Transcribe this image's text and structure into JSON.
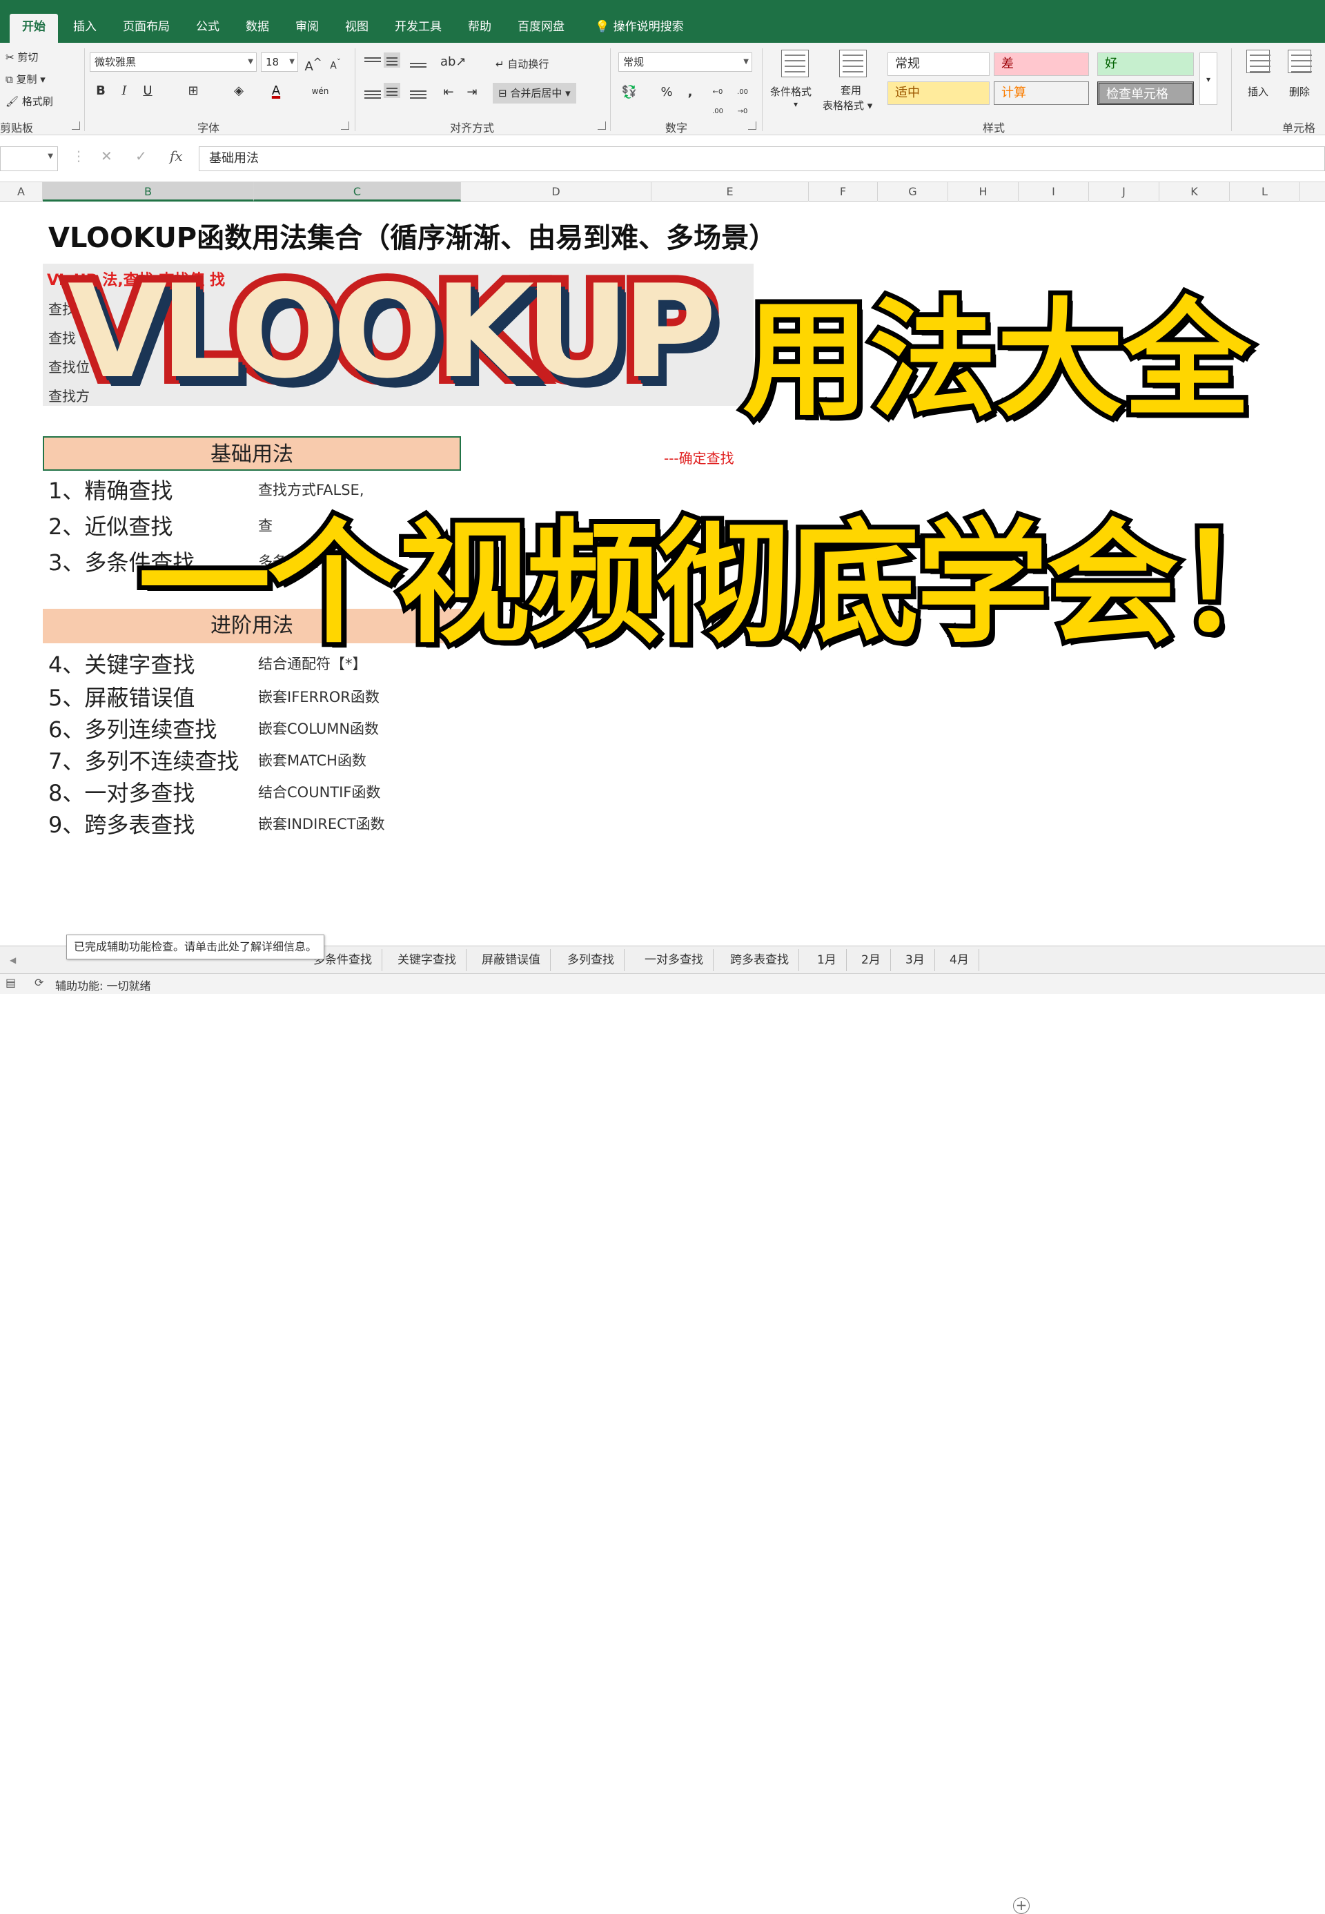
{
  "ribbon_tabs": [
    "开始",
    "插入",
    "页面布局",
    "公式",
    "数据",
    "审阅",
    "视图",
    "开发工具",
    "帮助",
    "百度网盘",
    "操作说明搜索"
  ],
  "clipboard": {
    "cut": "剪切",
    "copy": "复制",
    "painter": "格式刷",
    "group": "剪贴板"
  },
  "font": {
    "name": "微软雅黑",
    "size": "18",
    "bold": "B",
    "italic": "I",
    "underline": "U",
    "grow": "A",
    "shrink": "A",
    "color_glyph": "A",
    "phonetic": "wén",
    "group": "字体"
  },
  "align": {
    "wrap": "自动换行",
    "merge": "合并后居中",
    "group": "对齐方式"
  },
  "number": {
    "format": "常规",
    "percent": "%",
    "comma": ",",
    "inc": "←0 .00",
    "dec": ".00 →0",
    "group": "数字"
  },
  "styles": {
    "cond": "条件格式",
    "table1": "套用",
    "table2": "表格格式",
    "normal": "常规",
    "bad": "差",
    "good": "好",
    "neutral": "适中",
    "calc": "计算",
    "check": "检查单元格",
    "group": "样式"
  },
  "cells": {
    "insert": "插入",
    "delete": "删除",
    "group": "单元格"
  },
  "formula": {
    "cancel": "✕",
    "enter": "✓",
    "fx": "fx",
    "value": "基础用法"
  },
  "columns": [
    "A",
    "B",
    "C",
    "D",
    "E",
    "F",
    "G",
    "H",
    "I",
    "J",
    "K",
    "L"
  ],
  "sheet": {
    "title": "VLOOKUP函数用法集合（循序渐渐、由易到难、多场景）",
    "red_line": "VL      UP        法,查找       查找值      找",
    "gray_lines": [
      "查找",
      "查找",
      "查找位",
      "查找方"
    ],
    "red_tail": "---确定查找",
    "basic": "基础用法",
    "advanced": "进阶用法",
    "items": [
      {
        "num": "1、",
        "name": "精确查找",
        "desc": "查找方式FALSE,"
      },
      {
        "num": "2、",
        "name": "近似查找",
        "desc": "查"
      },
      {
        "num": "3、",
        "name": "多条件查找",
        "desc": "多条件    符【&"
      },
      {
        "num": "4、",
        "name": "关键字查找",
        "desc": "结合通配符【*】"
      },
      {
        "num": "5、",
        "name": "屏蔽错误值",
        "desc": "嵌套IFERROR函数"
      },
      {
        "num": "6、",
        "name": "多列连续查找",
        "desc": "嵌套COLUMN函数"
      },
      {
        "num": "7、",
        "name": "多列不连续查找",
        "desc": "嵌套MATCH函数"
      },
      {
        "num": "8、",
        "name": "一对多查找",
        "desc": "结合COUNTIF函数"
      },
      {
        "num": "9、",
        "name": "跨多表查找",
        "desc": "嵌套INDIRECT函数"
      }
    ]
  },
  "overlay": {
    "word": "VLOOKUP",
    "usage": "用法大全",
    "subtitle": "一个视频彻底学会！"
  },
  "sheet_tabs": [
    "多条件查找",
    "关键字查找",
    "屏蔽错误值",
    "多列查找",
    "一对多查找",
    "跨多表查找",
    "1月",
    "2月",
    "3月",
    "4月"
  ],
  "tooltip": "已完成辅助功能检查。请单击此处了解详细信息。",
  "status": "辅助功能: 一切就绪",
  "colors": {
    "excel_green": "#1e7145",
    "header_fill": "#f8cbad",
    "overlay_yellow": "#ffd600",
    "overlay_red": "#c81e1e"
  }
}
